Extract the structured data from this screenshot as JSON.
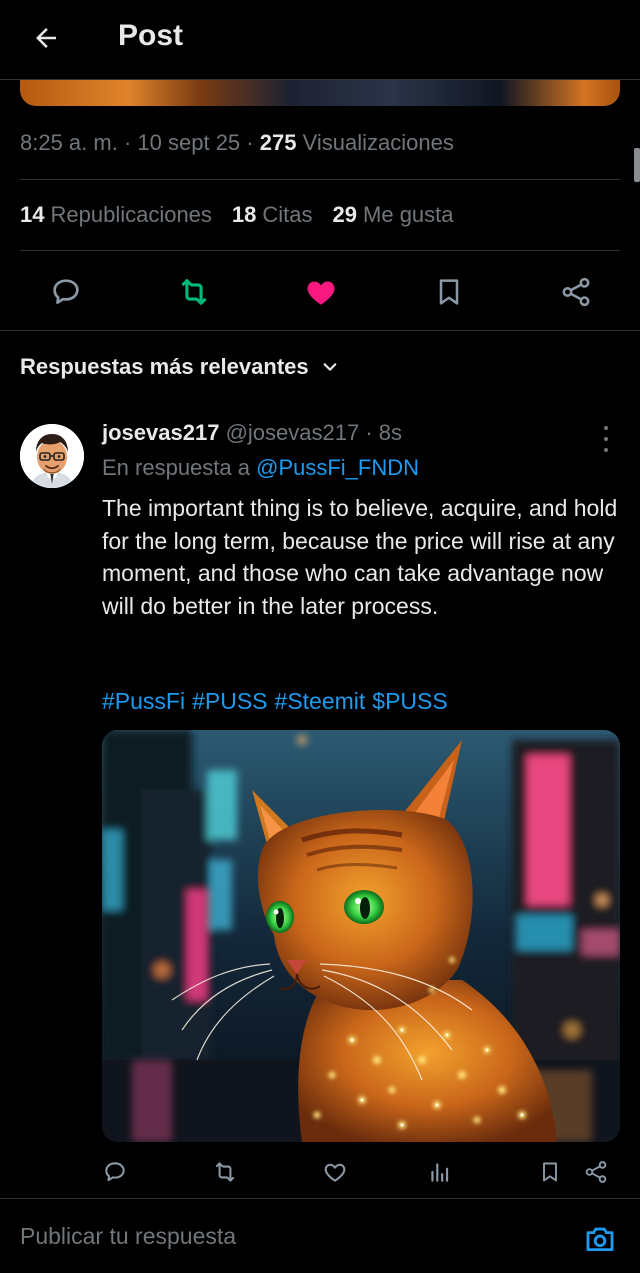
{
  "header": {
    "title": "Post"
  },
  "post": {
    "time": "8:25 a. m.",
    "date": "10 sept 25",
    "views_count": "275",
    "views_label": "Visualizaciones",
    "reposts_count": "14",
    "reposts_label": "Republicaciones",
    "quotes_count": "18",
    "quotes_label": "Citas",
    "likes_count": "29",
    "likes_label": "Me gusta"
  },
  "sort": {
    "label": "Respuestas más relevantes"
  },
  "reply": {
    "display_name": "josevas217",
    "handle": "@josevas217",
    "age": "8s",
    "reply_prefix": "En respuesta a",
    "reply_to": "@PussFi_FNDN",
    "text": "The important thing is to believe, acquire, and hold for the long term, because the price will rise at any moment, and those who can take advantage now will do better in the later process.",
    "hashtags": [
      "#PussFi",
      "#PUSS",
      "#Steemit",
      "$PUSS"
    ]
  },
  "compose": {
    "placeholder": "Publicar tu respuesta"
  },
  "colors": {
    "accent": "#1d9bf0",
    "repost_active": "#00ba7c",
    "like_active": "#f91880",
    "muted": "#71767b"
  },
  "icons": [
    "back-arrow-icon",
    "reply-icon",
    "repost-icon",
    "heart-filled-icon",
    "bookmark-icon",
    "share-icon",
    "chevron-down-icon",
    "more-vertical-icon",
    "analytics-icon",
    "camera-icon"
  ]
}
